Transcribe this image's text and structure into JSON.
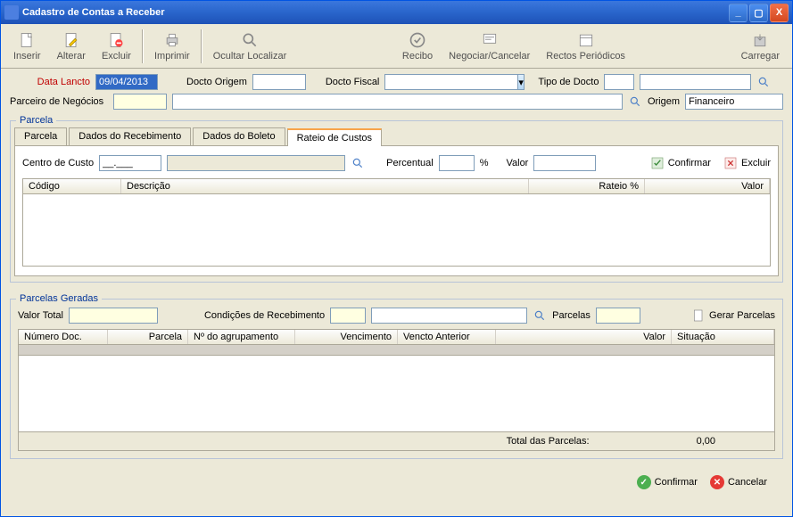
{
  "window": {
    "title": "Cadastro de Contas a Receber"
  },
  "toolbar": {
    "inserir": "Inserir",
    "alterar": "Alterar",
    "excluir": "Excluir",
    "imprimir": "Imprimir",
    "ocultar_localizar": "Ocultar Localizar",
    "recibo": "Recibo",
    "negociar_cancelar": "Negociar/Cancelar",
    "rectos_periodicos": "Rectos Periódicos",
    "carregar": "Carregar"
  },
  "form": {
    "data_lancto_label": "Data Lancto",
    "data_lancto_value": "09/04/2013",
    "docto_origem_label": "Docto Origem",
    "docto_origem_value": "",
    "docto_fiscal_label": "Docto Fiscal",
    "docto_fiscal_value": "",
    "tipo_docto_label": "Tipo de Docto",
    "tipo_docto_value": "",
    "parceiro_label": "Parceiro de Negócios",
    "parceiro_code": "",
    "parceiro_desc": "",
    "origem_label": "Origem",
    "origem_value": "Financeiro"
  },
  "parcela_fieldset": {
    "legend": "Parcela",
    "tabs": {
      "parcela": "Parcela",
      "dados_recebimento": "Dados do Recebimento",
      "dados_boleto": "Dados do Boleto",
      "rateio_custos": "Rateio de Custos"
    },
    "rateio": {
      "centro_custo_label": "Centro de Custo",
      "centro_custo_code": "__.___",
      "centro_custo_desc": "",
      "percentual_label": "Percentual",
      "percentual_value": "",
      "percentual_suffix": "%",
      "valor_label": "Valor",
      "valor_value": "",
      "confirmar": "Confirmar",
      "excluir": "Excluir",
      "columns": {
        "codigo": "Código",
        "descricao": "Descrição",
        "rateio_pct": "Rateio %",
        "valor": "Valor"
      }
    }
  },
  "parcelas_geradas": {
    "legend": "Parcelas Geradas",
    "valor_total_label": "Valor Total",
    "valor_total_value": "",
    "condicoes_label": "Condições de Recebimento",
    "condicoes_code": "",
    "condicoes_desc": "",
    "parcelas_label": "Parcelas",
    "parcelas_value": "",
    "gerar": "Gerar Parcelas",
    "columns": {
      "numero_doc": "Número Doc.",
      "parcela": "Parcela",
      "n_agrupamento": "Nº do agrupamento",
      "vencimento": "Vencimento",
      "vencto_anterior": "Vencto Anterior",
      "valor": "Valor",
      "situacao": "Situação"
    },
    "total_label": "Total das Parcelas:",
    "total_value": "0,00"
  },
  "bottom": {
    "confirmar": "Confirmar",
    "cancelar": "Cancelar"
  }
}
